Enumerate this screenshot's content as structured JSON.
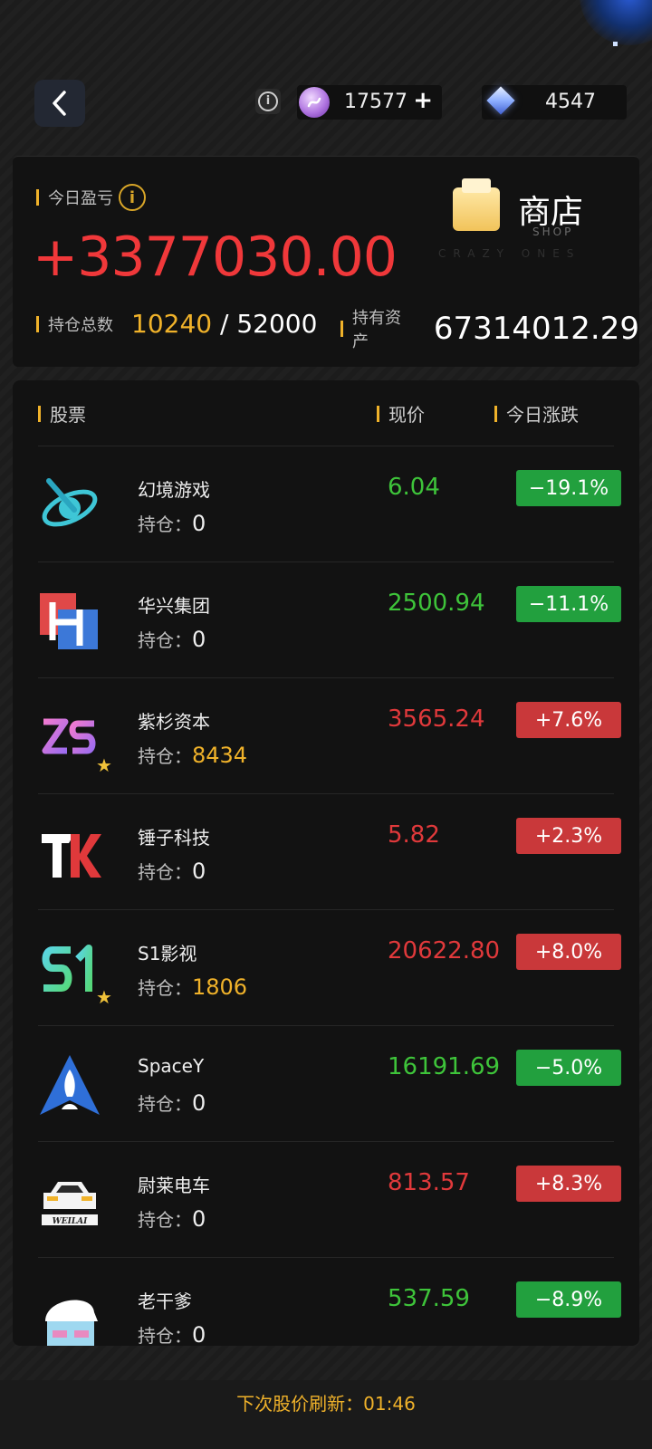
{
  "header": {
    "info_icon": "info-icon",
    "coin": {
      "value": "17577",
      "plus": "+"
    },
    "gem": {
      "value": "4547"
    }
  },
  "summary": {
    "pnl_label": "今日盈亏",
    "pnl_value": "+3377030.00",
    "shop_title": "商店",
    "shop_sub": "SHOP",
    "shop_bg_text": "CRAZY ONES",
    "positions_label": "持仓总数",
    "positions_held": "10240",
    "positions_sep": " / ",
    "positions_max": "52000",
    "assets_label": "持有资产",
    "assets_value": "67314012.29"
  },
  "list": {
    "headers": {
      "stock": "股票",
      "price": "现价",
      "change": "今日涨跌"
    },
    "hold_label": "持仓：",
    "rows": [
      {
        "name": "幻境游戏",
        "hold": "0",
        "price": "6.04",
        "change": "−19.1%",
        "trend": "down",
        "icon": "planet-icon",
        "starred": false
      },
      {
        "name": "华兴集团",
        "hold": "0",
        "price": "2500.94",
        "change": "−11.1%",
        "trend": "down",
        "icon": "h-logo-icon",
        "starred": false
      },
      {
        "name": "紫杉资本",
        "hold": "8434",
        "price": "3565.24",
        "change": "+7.6%",
        "trend": "up",
        "icon": "zs-logo-icon",
        "starred": true
      },
      {
        "name": "锤子科技",
        "hold": "0",
        "price": "5.82",
        "change": "+2.3%",
        "trend": "up",
        "icon": "tk-logo-icon",
        "starred": false
      },
      {
        "name": "S1影视",
        "hold": "1806",
        "price": "20622.80",
        "change": "+8.0%",
        "trend": "up",
        "icon": "s1-logo-icon",
        "starred": true
      },
      {
        "name": "SpaceY",
        "hold": "0",
        "price": "16191.69",
        "change": "−5.0%",
        "trend": "down",
        "icon": "rocket-icon",
        "starred": false
      },
      {
        "name": "尉莱电车",
        "hold": "0",
        "price": "813.57",
        "change": "+8.3%",
        "trend": "up",
        "icon": "car-icon",
        "car_text": "WEILAI",
        "starred": false
      },
      {
        "name": "老干爹",
        "hold": "0",
        "price": "537.59",
        "change": "−8.9%",
        "trend": "down",
        "icon": "face-icon",
        "starred": false
      }
    ]
  },
  "footer": {
    "refresh_text": "下次股价刷新：01:46"
  },
  "colors": {
    "gold": "#f0b22a",
    "red": "#e0393b",
    "green": "#3ec43a"
  }
}
